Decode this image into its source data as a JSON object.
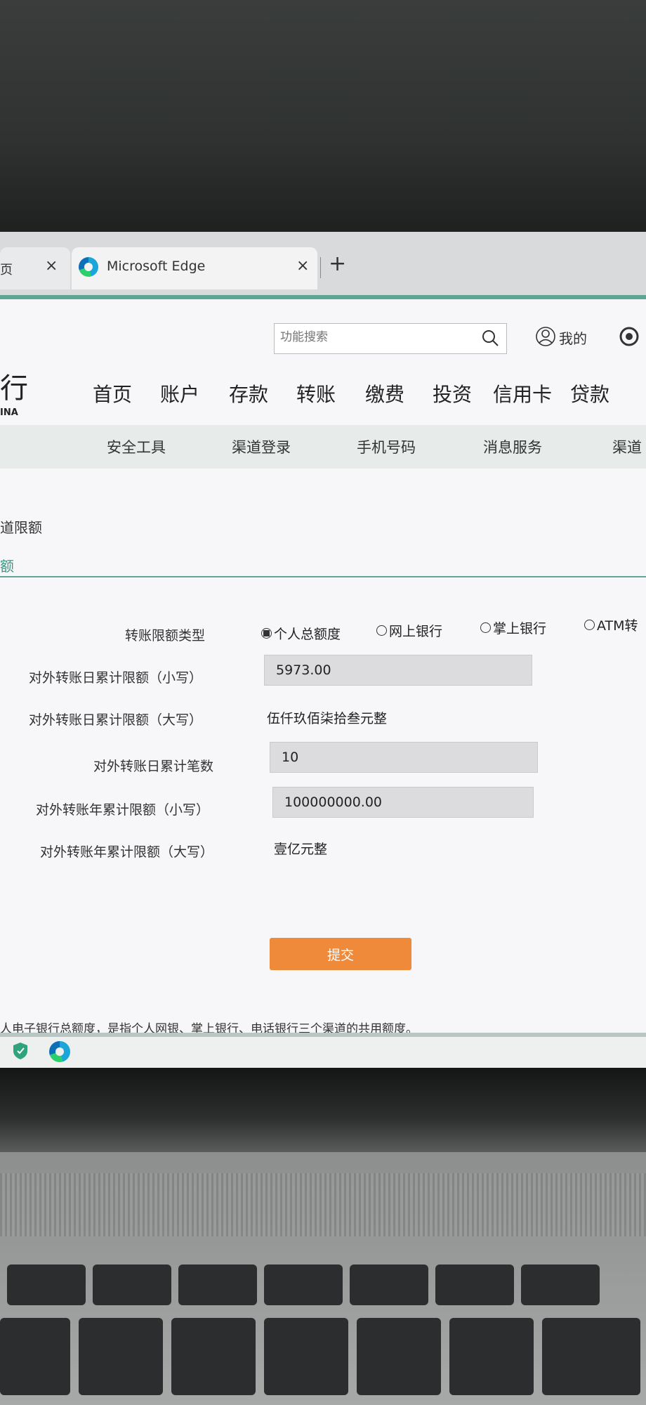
{
  "browser": {
    "prev_tab_text": "页",
    "active_tab_title": "Microsoft Edge",
    "close_glyph": "×",
    "new_tab_glyph": "+"
  },
  "header": {
    "search_placeholder": "功能搜索",
    "user_label": "我的"
  },
  "logo": {
    "char": "行",
    "sub": "INA"
  },
  "main_nav": [
    "首页",
    "账户",
    "存款",
    "转账",
    "缴费",
    "投资",
    "信用卡",
    "贷款"
  ],
  "sub_nav": [
    "安全工具",
    "渠道登录",
    "手机号码",
    "消息服务",
    "渠道"
  ],
  "breadcrumb": "道限额",
  "section_tab": "额",
  "form": {
    "type_label": "转账限额类型",
    "radios": [
      {
        "label": "个人总额度",
        "selected": true
      },
      {
        "label": "网上银行",
        "selected": false
      },
      {
        "label": "掌上银行",
        "selected": false
      },
      {
        "label": "ATM转",
        "selected": false
      }
    ],
    "daily_amount_label": "对外转账日累计限额（小写）",
    "daily_amount_value": "5973.00",
    "daily_amount_upper_label": "对外转账日累计限额（大写）",
    "daily_amount_upper_value": "伍仟玖佰柒拾叁元整",
    "daily_count_label": "对外转账日累计笔数",
    "daily_count_value": "10",
    "yearly_amount_label": "对外转账年累计限额（小写）",
    "yearly_amount_value": "100000000.00",
    "yearly_amount_upper_label": "对外转账年累计限额（大写）",
    "yearly_amount_upper_value": "壹亿元整",
    "submit_label": "提交"
  },
  "footnote": "人电子银行总额度，是指个人网银、掌上银行、电话银行三个渠道的共用额度。",
  "colors": {
    "accent_green": "#5fa595",
    "submit_orange": "#ef8a3a"
  }
}
